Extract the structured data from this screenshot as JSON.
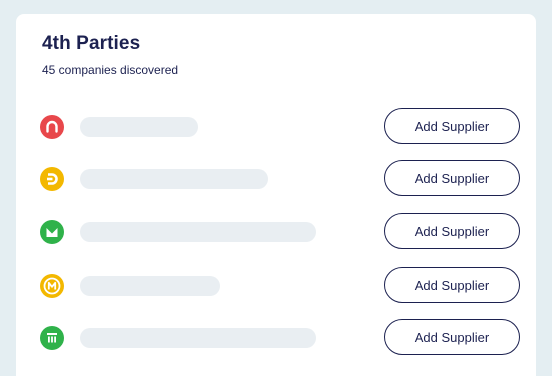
{
  "panel": {
    "title": "4th Parties",
    "subtitle": "45 companies discovered"
  },
  "rows": [
    {
      "logo_icon": "red-arch-logo-icon",
      "logo_color": "#e8474b",
      "button_label": "Add Supplier"
    },
    {
      "logo_icon": "yellow-d-logo-icon",
      "logo_color": "#f3b800",
      "button_label": "Add Supplier"
    },
    {
      "logo_icon": "green-m-logo-icon",
      "logo_color": "#2fb24a",
      "button_label": "Add Supplier"
    },
    {
      "logo_icon": "yellow-circle-m-logo-icon",
      "logo_color": "#f3b800",
      "button_label": "Add Supplier"
    },
    {
      "logo_icon": "green-columns-logo-icon",
      "logo_color": "#2fb24a",
      "button_label": "Add Supplier"
    }
  ],
  "colors": {
    "background": "#e4eef2",
    "card": "#ffffff",
    "text_primary": "#1c2150",
    "placeholder_bar": "#e9eef2"
  }
}
